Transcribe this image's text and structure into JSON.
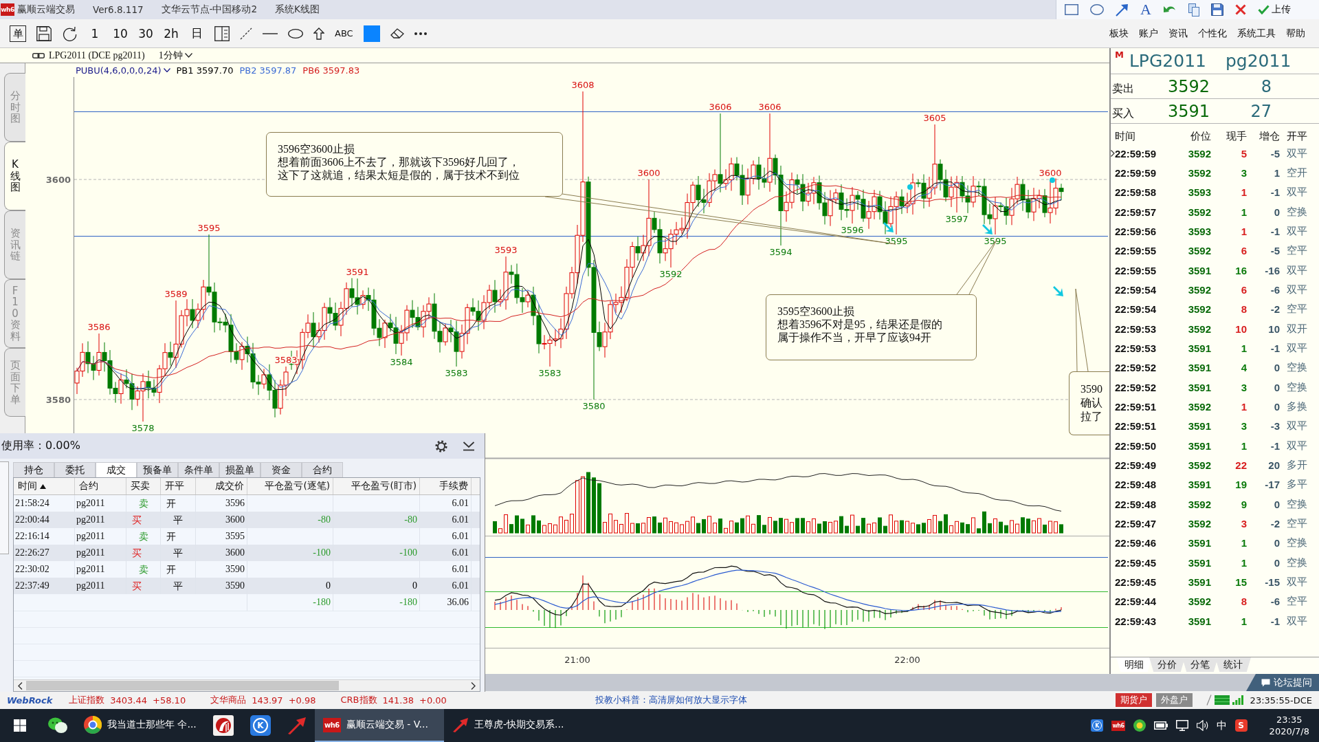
{
  "title_bar": {
    "logo": "wh6",
    "app_name": "赢顺云端交易",
    "version": "Ver6.8.117",
    "node": "文华云节点-中国移动2",
    "view": "系统K线图",
    "text_tool": "A",
    "upload_button": "上传"
  },
  "toolbar": {
    "order_key": "单",
    "periods": [
      "1",
      "10",
      "30",
      "2h",
      "日"
    ],
    "text_tool": "ABC",
    "menus": [
      "板块",
      "账户",
      "资讯",
      "个性化",
      "系统工具",
      "帮助"
    ]
  },
  "chart": {
    "symbol": "LPG2011 (DCE pg2011)",
    "period": "1分钟",
    "indicator": {
      "name": "PUBU(4,6,0,0,0,24)",
      "values": [
        {
          "label": "PB1 3597.70",
          "color": "#000000"
        },
        {
          "label": "PB2 3597.87",
          "color": "#3a6ad4"
        },
        {
          "label": "PB6 3597.83",
          "color": "#d42020"
        }
      ]
    },
    "side_tabs": [
      {
        "label": "分时图",
        "selected": false
      },
      {
        "label": "K线图",
        "selected": true
      },
      {
        "label": "资讯链",
        "selected": false
      },
      {
        "label": "F10资料",
        "selected": false
      },
      {
        "label": "页面下单",
        "selected": false
      }
    ],
    "y_labels": [
      "3600",
      "3580"
    ],
    "price_marks": [
      {
        "text": "3586",
        "kind": "high"
      },
      {
        "text": "3578",
        "kind": "low"
      },
      {
        "text": "3589",
        "kind": "high"
      },
      {
        "text": "3595",
        "kind": "high"
      },
      {
        "text": "3583",
        "kind": "high"
      },
      {
        "text": "3591",
        "kind": "high"
      },
      {
        "text": "3584",
        "kind": "low"
      },
      {
        "text": "3583",
        "kind": "low"
      },
      {
        "text": "3593",
        "kind": "high"
      },
      {
        "text": "3583",
        "kind": "low"
      },
      {
        "text": "3608",
        "kind": "high"
      },
      {
        "text": "3580",
        "kind": "low"
      },
      {
        "text": "3600",
        "kind": "high"
      },
      {
        "text": "3592",
        "kind": "low"
      },
      {
        "text": "3606",
        "kind": "high"
      },
      {
        "text": "3606",
        "kind": "high"
      },
      {
        "text": "3594",
        "kind": "low"
      },
      {
        "text": "3596",
        "kind": "low"
      },
      {
        "text": "3595",
        "kind": "low"
      },
      {
        "text": "3605",
        "kind": "high"
      },
      {
        "text": "3597",
        "kind": "low"
      },
      {
        "text": "3595",
        "kind": "low"
      },
      {
        "text": "3600",
        "kind": "high"
      }
    ],
    "notes": [
      {
        "lines": [
          "3596空3600止损",
          "想着前面3606上不去了，那就该下3596好几回了，",
          "这下了这就追，结果太短是假的，属于技术不到位"
        ]
      },
      {
        "lines": [
          "3595空3600止损",
          "想着3596不对是95，结果还是假的",
          "属于操作不当，开早了应该94开"
        ]
      },
      {
        "lines": [
          "3590",
          "确认",
          "拉了"
        ]
      }
    ],
    "time_labels": [
      "21:00",
      "22:00"
    ]
  },
  "quote_panel": {
    "market_mark": "M",
    "symbol": "LPG2011",
    "code": "pg2011",
    "ask": {
      "label": "卖出",
      "price": "3592",
      "volume": "8"
    },
    "bid": {
      "label": "买入",
      "price": "3591",
      "volume": "27"
    },
    "columns": [
      "时间",
      "价位",
      "现手",
      "增仓",
      "开平"
    ],
    "ticks": [
      {
        "time": "22:59:59",
        "price": "3592",
        "volume": "5",
        "color": "#d81e1e",
        "oi_change": "-5",
        "type": "双平",
        "current": true
      },
      {
        "time": "22:59:59",
        "price": "3592",
        "volume": "3",
        "color": "#0a7a0a",
        "oi_change": "1",
        "type": "空开",
        "current": false
      },
      {
        "time": "22:59:58",
        "price": "3593",
        "volume": "1",
        "color": "#d81e1e",
        "oi_change": "-1",
        "type": "双平",
        "current": false
      },
      {
        "time": "22:59:57",
        "price": "3592",
        "volume": "1",
        "color": "#0a7a0a",
        "oi_change": "0",
        "type": "空换",
        "current": false
      },
      {
        "time": "22:59:56",
        "price": "3593",
        "volume": "1",
        "color": "#d81e1e",
        "oi_change": "-1",
        "type": "双平",
        "current": false
      },
      {
        "time": "22:59:55",
        "price": "3592",
        "volume": "6",
        "color": "#d81e1e",
        "oi_change": "-5",
        "type": "空平",
        "current": false
      },
      {
        "time": "22:59:55",
        "price": "3591",
        "volume": "16",
        "color": "#0a7a0a",
        "oi_change": "-16",
        "type": "双平",
        "current": false
      },
      {
        "time": "22:59:54",
        "price": "3592",
        "volume": "6",
        "color": "#d81e1e",
        "oi_change": "-6",
        "type": "双平",
        "current": false
      },
      {
        "time": "22:59:54",
        "price": "3592",
        "volume": "8",
        "color": "#d81e1e",
        "oi_change": "-2",
        "type": "空平",
        "current": false
      },
      {
        "time": "22:59:53",
        "price": "3592",
        "volume": "10",
        "color": "#d81e1e",
        "oi_change": "10",
        "type": "双开",
        "current": false
      },
      {
        "time": "22:59:53",
        "price": "3591",
        "volume": "1",
        "color": "#0a7a0a",
        "oi_change": "-1",
        "type": "双平",
        "current": false
      },
      {
        "time": "22:59:52",
        "price": "3591",
        "volume": "4",
        "color": "#0a7a0a",
        "oi_change": "0",
        "type": "空换",
        "current": false
      },
      {
        "time": "22:59:52",
        "price": "3591",
        "volume": "3",
        "color": "#0a7a0a",
        "oi_change": "0",
        "type": "空换",
        "current": false
      },
      {
        "time": "22:59:51",
        "price": "3592",
        "volume": "1",
        "color": "#d81e1e",
        "oi_change": "0",
        "type": "多换",
        "current": false
      },
      {
        "time": "22:59:51",
        "price": "3591",
        "volume": "3",
        "color": "#0a7a0a",
        "oi_change": "-3",
        "type": "双平",
        "current": false
      },
      {
        "time": "22:59:50",
        "price": "3591",
        "volume": "1",
        "color": "#0a7a0a",
        "oi_change": "-1",
        "type": "双平",
        "current": false
      },
      {
        "time": "22:59:49",
        "price": "3592",
        "volume": "22",
        "color": "#d81e1e",
        "oi_change": "20",
        "type": "多开",
        "current": false
      },
      {
        "time": "22:59:48",
        "price": "3591",
        "volume": "19",
        "color": "#0a7a0a",
        "oi_change": "-17",
        "type": "多平",
        "current": false
      },
      {
        "time": "22:59:48",
        "price": "3592",
        "volume": "9",
        "color": "#0a7a0a",
        "oi_change": "0",
        "type": "空换",
        "current": false
      },
      {
        "time": "22:59:47",
        "price": "3592",
        "volume": "3",
        "color": "#d81e1e",
        "oi_change": "-2",
        "type": "空平",
        "current": false
      },
      {
        "time": "22:59:46",
        "price": "3591",
        "volume": "1",
        "color": "#0a7a0a",
        "oi_change": "0",
        "type": "空换",
        "current": false
      },
      {
        "time": "22:59:45",
        "price": "3591",
        "volume": "1",
        "color": "#0a7a0a",
        "oi_change": "0",
        "type": "空换",
        "current": false
      },
      {
        "time": "22:59:45",
        "price": "3591",
        "volume": "15",
        "color": "#0a7a0a",
        "oi_change": "-15",
        "type": "双平",
        "current": false
      },
      {
        "time": "22:59:44",
        "price": "3592",
        "volume": "8",
        "color": "#d81e1e",
        "oi_change": "-6",
        "type": "空平",
        "current": false
      },
      {
        "time": "22:59:43",
        "price": "3591",
        "volume": "1",
        "color": "#0a7a0a",
        "oi_change": "-1",
        "type": "双平",
        "current": false
      }
    ],
    "tabs": [
      {
        "label": "明细",
        "selected": true
      },
      {
        "label": "分价",
        "selected": false
      },
      {
        "label": "分笔",
        "selected": false
      },
      {
        "label": "统计",
        "selected": false
      }
    ]
  },
  "trade_panel": {
    "usage": "使用率：0.00%",
    "tabs": [
      {
        "label": "持仓",
        "selected": false
      },
      {
        "label": "委托",
        "selected": false
      },
      {
        "label": "成交",
        "selected": true
      },
      {
        "label": "预备单",
        "selected": false
      },
      {
        "label": "条件单",
        "selected": false
      },
      {
        "label": "损盈单",
        "selected": false
      },
      {
        "label": "资金",
        "selected": false
      },
      {
        "label": "合约",
        "selected": false
      }
    ],
    "columns": [
      "时间",
      "合约",
      "买卖",
      "开平",
      "成交价",
      "平仓盈亏(逐笔)",
      "平仓盈亏(盯市)",
      "手续费"
    ],
    "rows": [
      {
        "kind": "sell",
        "time": "21:58:24",
        "contract": "pg2011",
        "side": {
          "text": "卖",
          "color": "#2a9a2a"
        },
        "open_close": "开",
        "price": "3596",
        "fee": "6.01"
      },
      {
        "kind": "buy",
        "time": "22:00:44",
        "contract": "pg2011",
        "side": {
          "text": "买",
          "color": "#e02020"
        },
        "open_close": "平",
        "price": "3600",
        "pnl_trade": {
          "text": "-80",
          "color": "#2a9a2a"
        },
        "pnl_mark": {
          "text": "-80",
          "color": "#2a9a2a"
        },
        "fee": "6.01"
      },
      {
        "kind": "sell",
        "time": "22:16:14",
        "contract": "pg2011",
        "side": {
          "text": "卖",
          "color": "#2a9a2a"
        },
        "open_close": "开",
        "price": "3595",
        "fee": "6.01"
      },
      {
        "kind": "buy",
        "time": "22:26:27",
        "contract": "pg2011",
        "side": {
          "text": "买",
          "color": "#e02020"
        },
        "open_close": "平",
        "price": "3600",
        "pnl_trade": {
          "text": "-100",
          "color": "#2a9a2a"
        },
        "pnl_mark": {
          "text": "-100",
          "color": "#2a9a2a"
        },
        "fee": "6.01"
      },
      {
        "kind": "sell",
        "time": "22:30:02",
        "contract": "pg2011",
        "side": {
          "text": "卖",
          "color": "#2a9a2a"
        },
        "open_close": "开",
        "price": "3590",
        "fee": "6.01"
      },
      {
        "kind": "buy",
        "time": "22:37:49",
        "contract": "pg2011",
        "side": {
          "text": "买",
          "color": "#e02020"
        },
        "open_close": "平",
        "price": "3590",
        "pnl_trade": {
          "text": "0",
          "color": "#000000"
        },
        "pnl_mark": {
          "text": "0",
          "color": "#000000"
        },
        "fee": "6.01"
      }
    ],
    "total": {
      "pnl_trade": {
        "text": "-180",
        "color": "#2a9a2a"
      },
      "pnl_mark": {
        "text": "-180",
        "color": "#2a9a2a"
      },
      "fee": "36.06"
    }
  },
  "bottom_bar": {
    "forum_button": "论坛提问"
  },
  "status_bar": {
    "logo": "WebRock",
    "indices": [
      {
        "name": "上证指数",
        "value": "3403.44",
        "change": "+58.10"
      },
      {
        "name": "文华商品",
        "value": "143.97",
        "change": "+0.98"
      },
      {
        "name": "CRB指数",
        "value": "141.38",
        "change": "+0.00"
      }
    ],
    "tip": "投教小科普：高清屏如何放大显示字体",
    "accounts": [
      {
        "label": "期货户",
        "selected": true
      },
      {
        "label": "外盘户",
        "selected": false
      }
    ],
    "clock": "23:35:55-DCE"
  },
  "taskbar": {
    "pinned_letter": "K",
    "windows": [
      {
        "kind": "browser",
        "label": "我当道士那些年 仐...",
        "active": false
      },
      {
        "kind": "logo",
        "logo": "wh6",
        "label": "赢顺云端交易 - V...",
        "active": true
      },
      {
        "kind": "arrow",
        "label": "王尊虎-快期交易系...",
        "active": false
      }
    ],
    "tray_letter": "K",
    "tray_logo": "wh6",
    "ime": "中",
    "ime_logo": "S",
    "time": "23:35",
    "date": "2020/7/8"
  }
}
